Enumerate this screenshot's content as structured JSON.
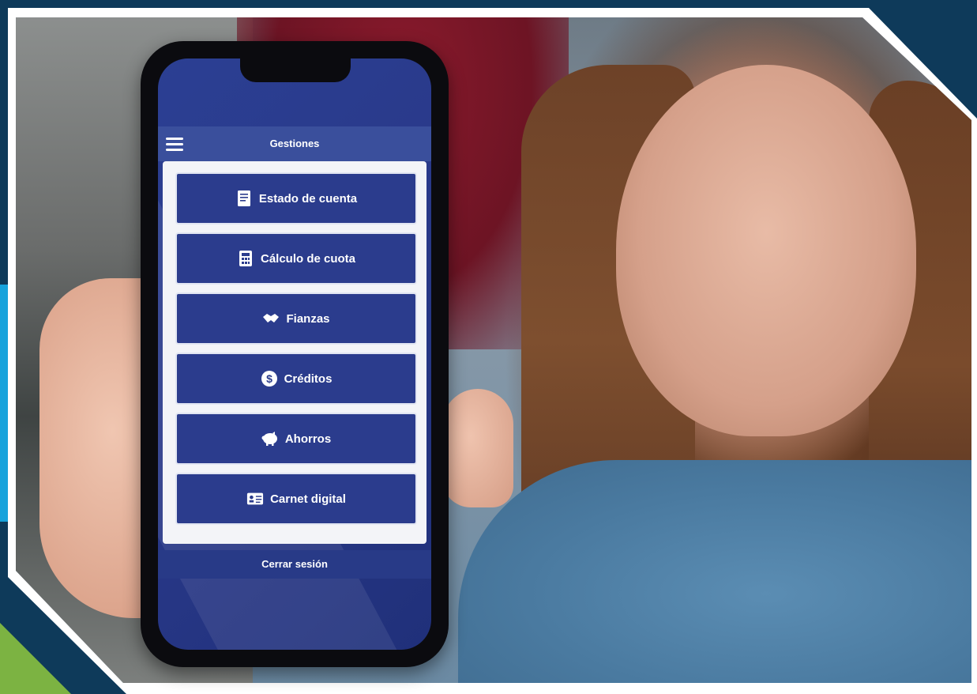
{
  "app": {
    "title": "Gestiones",
    "logout_label": "Cerrar sesión"
  },
  "menu": {
    "items": [
      {
        "label": "Estado de cuenta",
        "icon": "document-icon"
      },
      {
        "label": "Cálculo de cuota",
        "icon": "calculator-icon"
      },
      {
        "label": "Fianzas",
        "icon": "handshake-icon"
      },
      {
        "label": "Créditos",
        "icon": "dollar-coin-icon"
      },
      {
        "label": "Ahorros",
        "icon": "piggy-bank-icon"
      },
      {
        "label": "Carnet digital",
        "icon": "id-card-icon"
      }
    ]
  },
  "colors": {
    "app_blue": "#2b3c8d",
    "header_blue": "#3a4f9c",
    "frame_navy": "#0e3a5a",
    "accent_cyan": "#17a3dc",
    "accent_green": "#7cb342"
  }
}
